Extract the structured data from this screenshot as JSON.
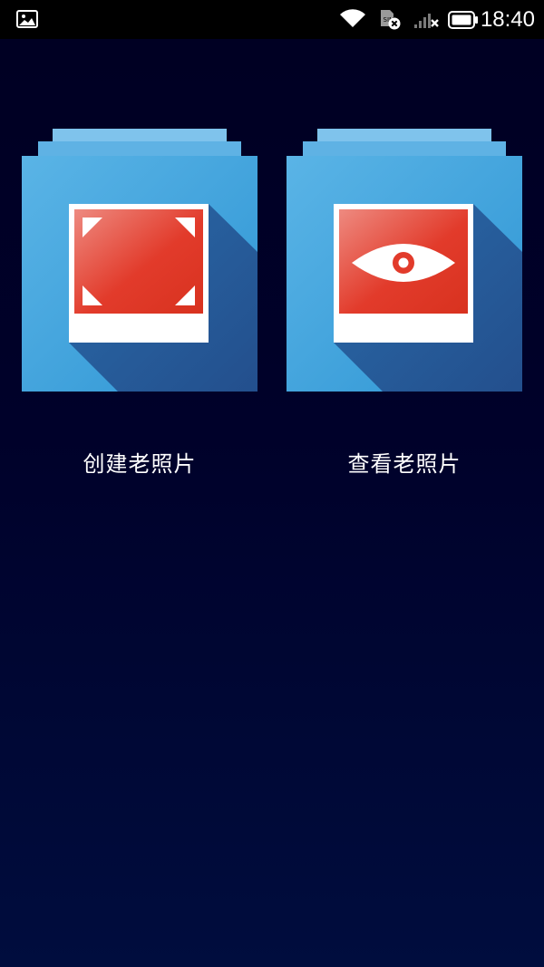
{
  "status_bar": {
    "time": "18:40",
    "icons": [
      "gallery-notification-icon",
      "wifi-icon",
      "sim-card-error-icon",
      "signal-no-service-icon",
      "battery-icon"
    ]
  },
  "tiles": [
    {
      "label": "创建老照片",
      "icon": "crop-frame-icon"
    },
    {
      "label": "查看老照片",
      "icon": "eye-icon"
    }
  ],
  "colors": {
    "background_top": "#000022",
    "background_bottom": "#000d3e",
    "tile_blue": "#3a9fd9",
    "tile_blue_light": "#5ab4e6",
    "tile_shadow": "#2a5f9e",
    "photo_red": "#e23b2b",
    "photo_frame": "#ffffff",
    "text": "#ffffff"
  }
}
